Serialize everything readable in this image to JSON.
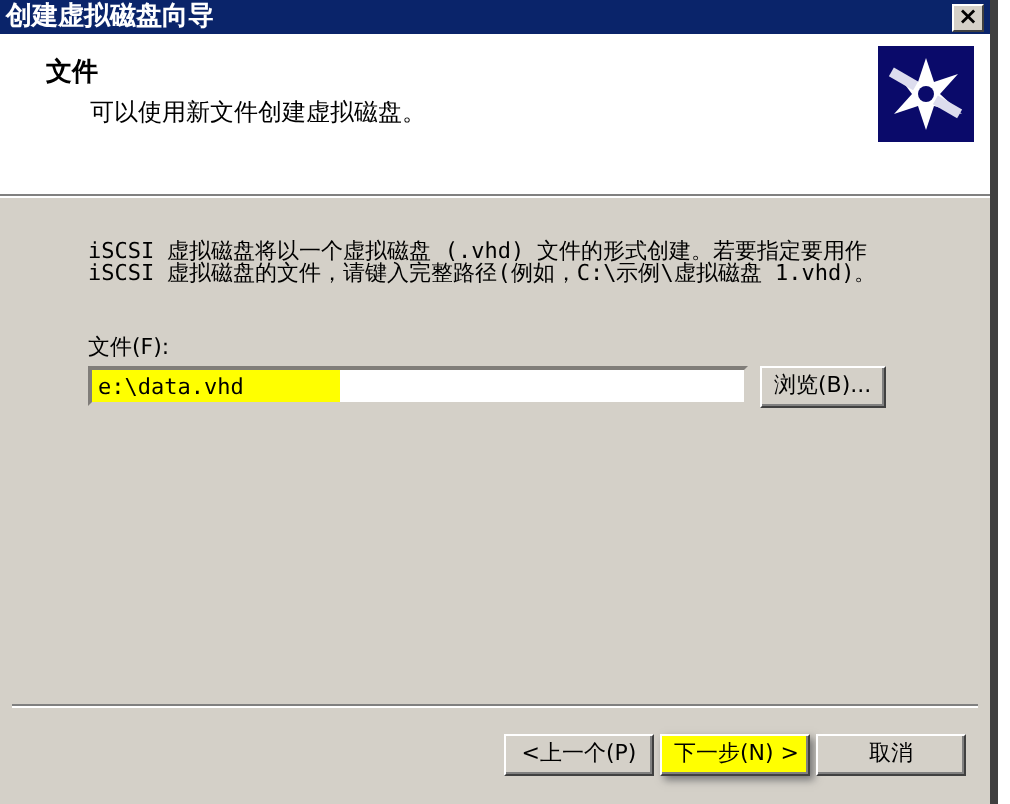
{
  "window": {
    "title": "创建虚拟磁盘向导",
    "close": "×"
  },
  "header": {
    "title": "文件",
    "subtitle": "可以使用新文件创建虚拟磁盘。"
  },
  "description": [
    "iSCSI 虚拟磁盘将以一个虚拟磁盘 (.vhd) 文件的形式创建。若要指定要用作",
    "iSCSI 虚拟磁盘的文件，请键入完整路径(例如，C:\\示例\\虚拟磁盘 1.vhd)。"
  ],
  "file_field": {
    "label": "文件(F):",
    "value": "e:\\data.vhd",
    "highlighted": true
  },
  "browse_button": {
    "label": "浏览(B)..."
  },
  "buttons": [
    {
      "label": "<上一个(P)",
      "highlighted": false
    },
    {
      "label": "下一步(N) >",
      "highlighted": true
    },
    {
      "label": "取消",
      "highlighted": false
    }
  ]
}
